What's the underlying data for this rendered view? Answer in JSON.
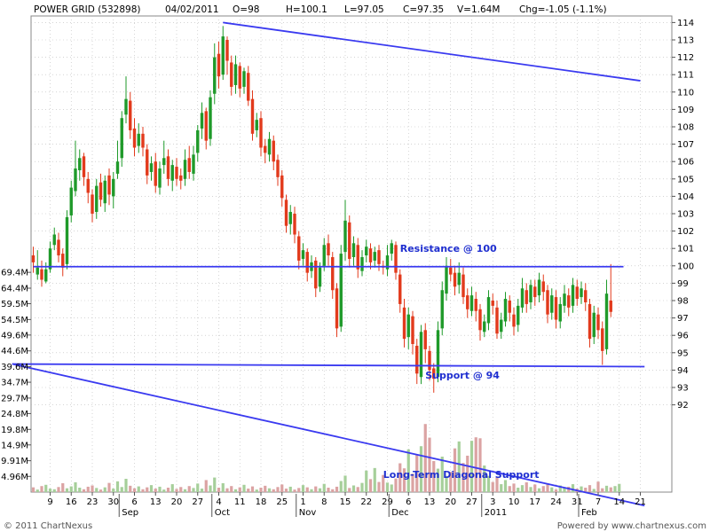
{
  "header": {
    "symbol": "POWER GRID (532898)",
    "date": "04/02/2011",
    "open": "O=98",
    "high": "H=100.1",
    "low": "L=97.05",
    "close": "C=97.35",
    "volume": "V=1.64M",
    "change": "Chg=-1.05 (-1.1%)"
  },
  "footer": {
    "copyright": "© 2011 ChartNexus",
    "powered": "Powered by www.chartnexus.com"
  },
  "chart_data": {
    "type": "candlestick",
    "title": "POWER GRID (532898)",
    "price_axis": {
      "ticks": [
        92,
        93,
        94,
        95,
        96,
        97,
        98,
        99,
        100,
        101,
        102,
        103,
        104,
        105,
        106,
        107,
        108,
        109,
        110,
        111,
        112,
        113,
        114
      ],
      "ylim": [
        91.3,
        114.2
      ]
    },
    "volume_axis": {
      "tick_labels": [
        "4.96M",
        "9.91M",
        "14.9M",
        "19.8M",
        "24.8M",
        "29.7M",
        "34.7M",
        "39.6M",
        "44.6M",
        "49.6M",
        "54.5M",
        "59.5M",
        "64.4M",
        "69.4M"
      ],
      "tick_values": [
        4.96,
        9.91,
        14.9,
        19.8,
        24.8,
        29.7,
        34.7,
        39.6,
        44.6,
        49.6,
        54.5,
        59.5,
        64.4,
        69.4
      ],
      "ylim": [
        0,
        70
      ]
    },
    "x_day_ticks": [
      {
        "label": "9",
        "i": 4
      },
      {
        "label": "16",
        "i": 9
      },
      {
        "label": "23",
        "i": 14
      },
      {
        "label": "30",
        "i": 19
      },
      {
        "label": "6",
        "i": 24
      },
      {
        "label": "13",
        "i": 29
      },
      {
        "label": "20",
        "i": 34
      },
      {
        "label": "27",
        "i": 39
      },
      {
        "label": "4",
        "i": 44
      },
      {
        "label": "11",
        "i": 49
      },
      {
        "label": "18",
        "i": 54
      },
      {
        "label": "25",
        "i": 59
      },
      {
        "label": "1",
        "i": 64
      },
      {
        "label": "8",
        "i": 69
      },
      {
        "label": "15",
        "i": 74
      },
      {
        "label": "22",
        "i": 79
      },
      {
        "label": "29",
        "i": 84
      },
      {
        "label": "6",
        "i": 89
      },
      {
        "label": "13",
        "i": 94
      },
      {
        "label": "20",
        "i": 99
      },
      {
        "label": "27",
        "i": 104
      },
      {
        "label": "3",
        "i": 109
      },
      {
        "label": "10",
        "i": 114
      },
      {
        "label": "17",
        "i": 119
      },
      {
        "label": "24",
        "i": 124
      },
      {
        "label": "31",
        "i": 129
      },
      {
        "label": "7",
        "i": 134
      },
      {
        "label": "14",
        "i": 139
      },
      {
        "label": "21",
        "i": 144
      }
    ],
    "x_month_ticks": [
      {
        "label": "Sep",
        "i": 21
      },
      {
        "label": "Oct",
        "i": 43
      },
      {
        "label": "Nov",
        "i": 63
      },
      {
        "label": "Dec",
        "i": 85
      },
      {
        "label": "2011",
        "i": 107
      },
      {
        "label": "Feb",
        "i": 130
      }
    ],
    "lines": [
      {
        "name": "resistance",
        "i1": 0,
        "p1": 99.95,
        "i2": 140,
        "p2": 99.95,
        "label": "Resistance @ 100",
        "label_i": 87,
        "label_p": 100.8
      },
      {
        "name": "support",
        "i1": -5,
        "p1": 94.35,
        "i2": 145,
        "p2": 94.2,
        "label": "Support @ 94",
        "label_i": 93,
        "label_p": 93.5
      },
      {
        "name": "diagonal-support",
        "i1": -5,
        "p1": 94.35,
        "i2": 145,
        "p2": 86.2,
        "label": "Long-Term Diagonal Support",
        "label_i": 83,
        "label_p": 87.8
      },
      {
        "name": "upper-trend",
        "i1": 45,
        "p1": 114.0,
        "i2": 144,
        "p2": 110.65,
        "label": "",
        "label_i": 0,
        "label_p": 0
      }
    ],
    "ohlc": [
      [
        100.6,
        100.2,
        101.1,
        99.6
      ],
      [
        99.5,
        99.9,
        100.9,
        99.2
      ],
      [
        99.8,
        99.2,
        100.3,
        98.8
      ],
      [
        99.1,
        99.8,
        100.2,
        99.0
      ],
      [
        99.8,
        101.0,
        101.4,
        99.6
      ],
      [
        101.2,
        101.8,
        102.2,
        100.9
      ],
      [
        101.5,
        100.6,
        101.9,
        100.2
      ],
      [
        100.7,
        99.9,
        101.0,
        99.4
      ],
      [
        100.1,
        102.8,
        103.2,
        99.8
      ],
      [
        102.9,
        104.5,
        104.9,
        102.5
      ],
      [
        104.3,
        105.6,
        107.2,
        104.0
      ],
      [
        105.5,
        106.2,
        106.7,
        104.9
      ],
      [
        106.3,
        105.1,
        106.5,
        104.6
      ],
      [
        105.0,
        104.2,
        105.4,
        103.6
      ],
      [
        104.1,
        103.0,
        104.4,
        102.5
      ],
      [
        103.1,
        104.6,
        105.0,
        102.7
      ],
      [
        104.8,
        103.8,
        105.3,
        103.4
      ],
      [
        103.6,
        104.9,
        105.2,
        103.1
      ],
      [
        105.2,
        104.1,
        105.6,
        103.5
      ],
      [
        104.0,
        105.0,
        105.4,
        103.3
      ],
      [
        105.3,
        106.0,
        107.2,
        105.0
      ],
      [
        106.2,
        108.5,
        108.9,
        105.7
      ],
      [
        108.7,
        109.6,
        110.9,
        108.2
      ],
      [
        109.5,
        107.8,
        110.0,
        107.3
      ],
      [
        107.9,
        106.8,
        108.5,
        106.3
      ],
      [
        106.9,
        107.6,
        108.2,
        106.5
      ],
      [
        107.6,
        106.8,
        108.0,
        106.3
      ],
      [
        106.7,
        105.2,
        107.0,
        104.7
      ],
      [
        105.4,
        105.9,
        106.3,
        104.9
      ],
      [
        106.0,
        104.6,
        106.5,
        104.2
      ],
      [
        104.5,
        105.6,
        106.0,
        104.1
      ],
      [
        105.8,
        106.2,
        107.2,
        105.3
      ],
      [
        106.3,
        105.0,
        106.7,
        104.6
      ],
      [
        104.9,
        105.8,
        106.1,
        104.3
      ],
      [
        105.7,
        105.0,
        106.2,
        104.6
      ],
      [
        105.2,
        104.9,
        105.6,
        104.4
      ],
      [
        105.0,
        106.1,
        106.7,
        104.6
      ],
      [
        106.2,
        105.4,
        106.9,
        105.0
      ],
      [
        105.3,
        106.4,
        106.9,
        104.9
      ],
      [
        106.5,
        107.8,
        108.1,
        106.0
      ],
      [
        107.9,
        108.8,
        109.4,
        107.3
      ],
      [
        108.9,
        107.2,
        109.1,
        106.7
      ],
      [
        107.3,
        109.7,
        110.1,
        106.9
      ],
      [
        109.9,
        112.0,
        112.8,
        109.3
      ],
      [
        112.2,
        110.9,
        112.9,
        110.2
      ],
      [
        111.0,
        113.2,
        113.8,
        110.7
      ],
      [
        113.0,
        111.8,
        113.2,
        111.0
      ],
      [
        111.7,
        110.3,
        112.1,
        109.8
      ],
      [
        110.4,
        111.6,
        112.1,
        109.9
      ],
      [
        111.5,
        110.2,
        111.7,
        109.7
      ],
      [
        110.3,
        111.2,
        111.4,
        109.9
      ],
      [
        111.1,
        109.5,
        111.5,
        109.2
      ],
      [
        109.6,
        107.6,
        110.1,
        107.2
      ],
      [
        107.8,
        108.4,
        108.8,
        107.4
      ],
      [
        108.5,
        106.8,
        108.9,
        106.3
      ],
      [
        106.9,
        106.5,
        107.3,
        105.9
      ],
      [
        106.4,
        107.3,
        107.7,
        106.0
      ],
      [
        107.2,
        106.0,
        107.5,
        105.5
      ],
      [
        106.1,
        105.1,
        106.4,
        104.6
      ],
      [
        105.2,
        103.9,
        105.5,
        103.4
      ],
      [
        103.8,
        102.3,
        104.1,
        101.9
      ],
      [
        102.4,
        103.1,
        103.5,
        101.8
      ],
      [
        103.0,
        101.8,
        103.4,
        101.3
      ],
      [
        101.7,
        100.3,
        102.0,
        99.8
      ],
      [
        100.4,
        100.9,
        101.3,
        100.0
      ],
      [
        100.8,
        99.6,
        101.0,
        99.1
      ],
      [
        99.7,
        100.2,
        100.6,
        99.3
      ],
      [
        100.3,
        98.7,
        100.5,
        98.2
      ],
      [
        98.8,
        99.9,
        100.2,
        98.5
      ],
      [
        100.0,
        101.2,
        101.6,
        99.7
      ],
      [
        101.3,
        100.6,
        101.8,
        100.0
      ],
      [
        100.5,
        98.6,
        100.8,
        98.1
      ],
      [
        98.7,
        96.4,
        99.0,
        95.9
      ],
      [
        96.5,
        100.7,
        101.2,
        96.2
      ],
      [
        100.8,
        102.6,
        103.8,
        100.3
      ],
      [
        102.5,
        100.4,
        102.9,
        99.9
      ],
      [
        100.5,
        101.3,
        101.7,
        100.0
      ],
      [
        101.2,
        99.8,
        101.6,
        99.3
      ],
      [
        99.7,
        100.5,
        100.9,
        99.4
      ],
      [
        100.6,
        101.1,
        101.5,
        100.2
      ],
      [
        101.0,
        100.2,
        101.3,
        99.8
      ],
      [
        100.3,
        100.8,
        101.1,
        99.9
      ],
      [
        100.9,
        100.1,
        101.2,
        99.7
      ],
      [
        100.0,
        99.9,
        100.3,
        99.5
      ],
      [
        99.8,
        100.6,
        101.2,
        99.4
      ],
      [
        100.7,
        101.3,
        101.5,
        100.3
      ],
      [
        101.2,
        99.6,
        101.4,
        99.2
      ],
      [
        99.5,
        97.8,
        99.8,
        97.3
      ],
      [
        97.6,
        95.8,
        98.1,
        95.3
      ],
      [
        95.9,
        97.2,
        97.6,
        95.2
      ],
      [
        97.1,
        95.5,
        97.4,
        94.9
      ],
      [
        95.4,
        93.8,
        95.8,
        93.2
      ],
      [
        93.6,
        96.2,
        96.6,
        93.2
      ],
      [
        96.3,
        95.2,
        96.7,
        94.4
      ],
      [
        95.1,
        94.0,
        95.4,
        93.4
      ],
      [
        94.1,
        93.5,
        94.4,
        92.7
      ],
      [
        93.6,
        96.3,
        96.8,
        93.3
      ],
      [
        96.4,
        98.6,
        99.1,
        96.0
      ],
      [
        98.4,
        100.0,
        100.5,
        98.0
      ],
      [
        99.9,
        99.5,
        100.4,
        99.1
      ],
      [
        99.6,
        98.8,
        100.0,
        98.3
      ],
      [
        98.9,
        99.6,
        100.2,
        98.4
      ],
      [
        99.5,
        98.2,
        99.9,
        97.8
      ],
      [
        98.3,
        97.5,
        98.7,
        97.0
      ],
      [
        97.4,
        98.3,
        98.8,
        97.1
      ],
      [
        98.1,
        97.4,
        98.5,
        96.8
      ],
      [
        97.5,
        96.3,
        97.8,
        95.7
      ],
      [
        96.2,
        96.8,
        97.2,
        95.9
      ],
      [
        96.7,
        98.2,
        98.6,
        96.3
      ],
      [
        98.0,
        97.7,
        98.4,
        97.2
      ],
      [
        97.6,
        96.1,
        98.0,
        95.8
      ],
      [
        96.2,
        96.9,
        97.3,
        95.8
      ],
      [
        96.8,
        98.1,
        98.5,
        96.5
      ],
      [
        98.0,
        97.3,
        98.3,
        96.8
      ],
      [
        97.2,
        96.5,
        97.6,
        96.0
      ],
      [
        96.6,
        97.7,
        98.1,
        96.2
      ],
      [
        97.6,
        98.7,
        99.3,
        97.3
      ],
      [
        98.6,
        97.8,
        99.0,
        97.3
      ],
      [
        97.9,
        98.9,
        99.2,
        97.5
      ],
      [
        98.8,
        98.2,
        99.2,
        97.7
      ],
      [
        98.3,
        99.2,
        99.6,
        97.9
      ],
      [
        99.1,
        98.5,
        99.5,
        98.0
      ],
      [
        98.6,
        97.2,
        98.9,
        96.7
      ],
      [
        97.3,
        98.3,
        98.7,
        96.9
      ],
      [
        98.2,
        96.9,
        98.6,
        96.4
      ],
      [
        96.8,
        97.8,
        98.2,
        96.4
      ],
      [
        97.7,
        98.4,
        98.9,
        97.3
      ],
      [
        98.3,
        97.6,
        98.7,
        97.1
      ],
      [
        97.7,
        98.9,
        99.3,
        97.3
      ],
      [
        98.8,
        98.1,
        99.2,
        97.7
      ],
      [
        98.2,
        98.7,
        99.1,
        97.8
      ],
      [
        98.6,
        97.9,
        99.0,
        97.4
      ],
      [
        97.8,
        95.8,
        98.1,
        95.3
      ],
      [
        95.9,
        97.3,
        97.7,
        95.5
      ],
      [
        97.2,
        96.3,
        97.6,
        95.8
      ],
      [
        96.4,
        95.1,
        96.8,
        94.3
      ],
      [
        95.2,
        98.4,
        99.2,
        94.9
      ],
      [
        98.0,
        97.35,
        100.1,
        97.05
      ]
    ],
    "volume": [
      1.5,
      0.8,
      1.9,
      2.3,
      1.1,
      0.9,
      1.6,
      2.8,
      1.2,
      1.8,
      3.1,
      1.4,
      0.9,
      1.7,
      2.1,
      1.3,
      0.8,
      1.5,
      2.9,
      1.1,
      3.4,
      1.6,
      4.2,
      2.0,
      1.2,
      1.8,
      0.9,
      1.5,
      2.2,
      1.1,
      1.7,
      0.8,
      1.4,
      2.5,
      1.0,
      1.6,
      0.9,
      1.9,
      1.3,
      2.7,
      1.1,
      3.8,
      2.1,
      4.6,
      1.4,
      2.8,
      1.2,
      1.9,
      0.9,
      1.5,
      2.3,
      1.1,
      1.8,
      0.8,
      1.4,
      2.0,
      1.2,
      0.9,
      1.6,
      2.4,
      1.1,
      1.7,
      0.8,
      1.3,
      2.2,
      1.5,
      0.9,
      1.8,
      1.2,
      2.6,
      1.4,
      0.9,
      1.7,
      3.5,
      5.2,
      1.3,
      2.1,
      1.6,
      2.9,
      6.8,
      4.1,
      7.6,
      3.2,
      5.4,
      3.0,
      2.4,
      4.3,
      9.1,
      7.5,
      13.5,
      5.8,
      11.8,
      14.5,
      21.5,
      17.2,
      9.8,
      7.4,
      11.2,
      5.1,
      6.4,
      13.8,
      16.0,
      9.2,
      11.5,
      16.2,
      17.3,
      17.0,
      8.4,
      5.1,
      3.2,
      4.6,
      2.5,
      3.8,
      1.9,
      2.7,
      1.4,
      2.2,
      3.1,
      1.6,
      2.4,
      1.2,
      1.9,
      2.8,
      1.5,
      0.9,
      2.1,
      1.3,
      1.7,
      2.5,
      1.1,
      1.8,
      1.4,
      2.2,
      1.0,
      3.3,
      1.2,
      2.0,
      1.5,
      1.9,
      2.6
    ]
  }
}
